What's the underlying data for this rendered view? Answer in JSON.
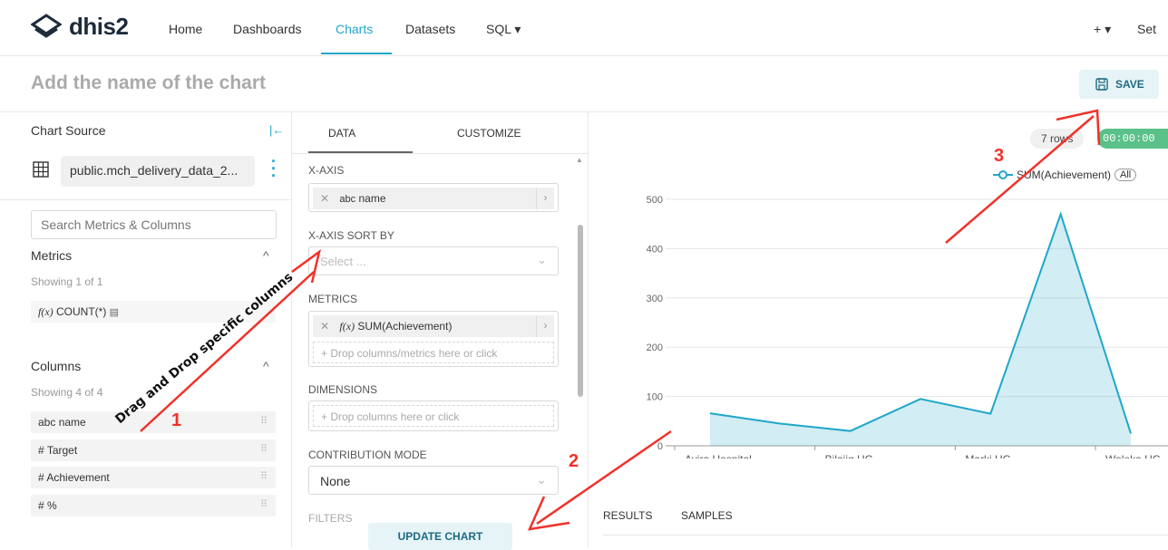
{
  "nav": {
    "logo_text": "dhis2",
    "items": [
      "Home",
      "Dashboards",
      "Charts",
      "Datasets",
      "SQL ▾"
    ],
    "active": "Charts",
    "plus_label": "+ ▾",
    "settings_partial": "Set"
  },
  "header": {
    "title_placeholder": "Add the name of the chart",
    "save_label": "SAVE"
  },
  "left": {
    "title": "Chart Source",
    "dataset": "public.mch_delivery_data_2...",
    "search_placeholder": "Search Metrics & Columns",
    "metrics_heading": "Metrics",
    "metrics_showing": "Showing 1 of 1",
    "metrics": [
      {
        "prefix": "f(x)",
        "label": "COUNT(*)"
      }
    ],
    "columns_heading": "Columns",
    "columns_showing": "Showing 4 of 4",
    "columns": [
      {
        "prefix": "abc",
        "label": "name"
      },
      {
        "prefix": "#",
        "label": "Target"
      },
      {
        "prefix": "#",
        "label": "Achievement"
      },
      {
        "prefix": "#",
        "label": "%"
      }
    ]
  },
  "middle": {
    "tabs": [
      "DATA",
      "CUSTOMIZE"
    ],
    "xaxis_label": "X-AXIS",
    "xaxis_value": "name",
    "xaxis_prefix": "abc",
    "xaxis_sort_label": "X-AXIS SORT BY",
    "xaxis_sort_placeholder": "Select ...",
    "metrics_label": "METRICS",
    "metric_value": "SUM(Achievement)",
    "metric_prefix": "f(x)",
    "metrics_drop": "+ Drop columns/metrics here or click",
    "dimensions_label": "DIMENSIONS",
    "dimensions_drop": "+ Drop columns here or click",
    "contribution_label": "CONTRIBUTION MODE",
    "contribution_value": "None",
    "filters_label": "FILTERS",
    "update_label": "UPDATE CHART"
  },
  "right": {
    "rows_badge": "7 rows",
    "time_badge": "00:00:00",
    "legend_label": "SUM(Achievement)",
    "legend_all": "All",
    "results_tabs": [
      "RESULTS",
      "SAMPLES"
    ]
  },
  "chart_data": {
    "type": "area",
    "x": [
      "Ayira Hospital",
      "",
      "Bilajig HC",
      "",
      "Marki HC",
      "",
      "Woleka HC"
    ],
    "tick_labels": [
      "Ayira Hospital",
      "Bilajig HC",
      "Marki HC",
      "Woleka HC"
    ],
    "series": [
      {
        "name": "SUM(Achievement)",
        "values": [
          66,
          45,
          30,
          95,
          65,
          470,
          25
        ]
      }
    ],
    "yticks": [
      0,
      100,
      200,
      300,
      400,
      500
    ],
    "ylim": [
      0,
      500
    ],
    "color": "#20a7c9"
  },
  "annotations": {
    "label_1": "1",
    "label_2": "2",
    "label_3": "3",
    "drag_text": "Drag and Drop specific columns",
    "arrow_color": "#f0312a"
  }
}
